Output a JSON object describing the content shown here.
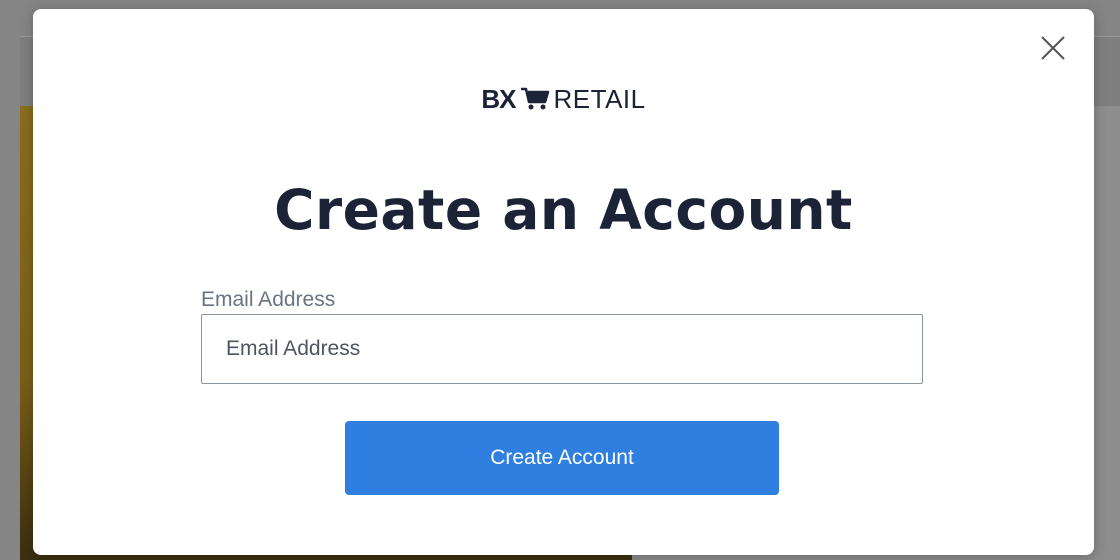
{
  "modal": {
    "logo": {
      "brand_bold": "BX",
      "cart_icon": "shopping-cart-icon",
      "brand_light": "RETAIL"
    },
    "title": "Create an Account",
    "email": {
      "label": "Email Address",
      "placeholder": "Email Address",
      "value": ""
    },
    "submit_label": "Create Account",
    "close_icon": "close-icon"
  },
  "colors": {
    "primary_button": "#2e7fdf",
    "heading": "#1c2336",
    "overlay": "#858585"
  }
}
